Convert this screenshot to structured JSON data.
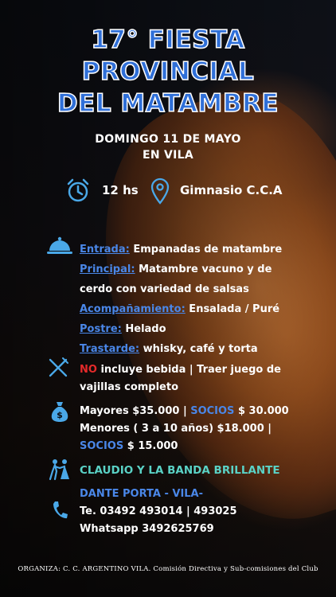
{
  "title": {
    "line1": "17° FIESTA",
    "line2": "PROVINCIAL",
    "line3": "DEL MATAMBRE"
  },
  "date": {
    "line1": "DOMINGO 11 DE MAYO",
    "line2": "EN VILA"
  },
  "info": {
    "time": "12 hs",
    "location": "Gimnasio C.C.A"
  },
  "menu": [
    {
      "label": "Entrada:",
      "text": " Empanadas de matambre"
    },
    {
      "label": "Principal:",
      "text": " Matambre vacuno y de"
    },
    {
      "label": "",
      "text": "cerdo con variedad de salsas"
    },
    {
      "label": "Acompañamiento:",
      "text": " Ensalada / Puré"
    },
    {
      "label": "Postre:",
      "text": " Helado"
    },
    {
      "label": "Trastarde:",
      "text": " whisky, café y torta"
    }
  ],
  "drinks": {
    "no": "NO",
    "line1_rest": " incluye bebida | Traer juego de",
    "line2": "vajillas completo"
  },
  "prices": {
    "line1_a": "Mayores $35.000 | ",
    "line1_socios": "SOCIOS",
    "line1_b": " $ 30.000",
    "line2": "Menores ( 3 a 10 años) $18.000 |",
    "line3_socios": "SOCIOS",
    "line3_b": " $ 15.000"
  },
  "band": "CLAUDIO Y LA BANDA BRILLANTE",
  "contact": {
    "name": "DANTE PORTA - VILA-",
    "phone": "Te. 03492 493014 | 493025",
    "whatsapp": "Whatsapp 3492625769"
  },
  "footer": "ORGANIZA: C. C. ARGENTINO VILA.  Comisión Directiva y Sub-comisiones del Club",
  "colors": {
    "title_blue": "#2f6fd8",
    "label_blue": "#4a87e8",
    "red": "#e52a2a",
    "teal": "#5ad2c6",
    "icon_blue": "#4aa8e8"
  }
}
